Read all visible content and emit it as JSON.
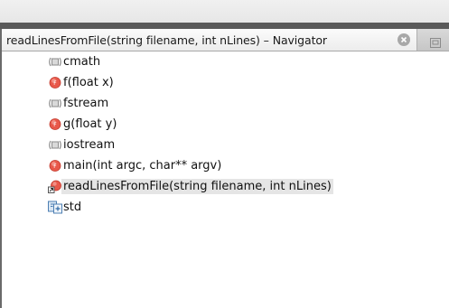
{
  "tab": {
    "title": "readLinesFromFile(string filename, int nLines) – Navigator"
  },
  "items": [
    {
      "label": "cmath",
      "icon": "include-icon"
    },
    {
      "label": "f(float x)",
      "icon": "function-icon"
    },
    {
      "label": "fstream",
      "icon": "include-icon"
    },
    {
      "label": "g(float y)",
      "icon": "function-icon"
    },
    {
      "label": "iostream",
      "icon": "include-icon"
    },
    {
      "label": "main(int argc, char** argv)",
      "icon": "function-icon"
    },
    {
      "label": "readLinesFromFile(string filename, int nLines)",
      "icon": "function-selected-icon",
      "selected": true
    },
    {
      "label": "std",
      "icon": "namespace-icon"
    }
  ],
  "colors": {
    "function": "#e8584a",
    "include": "#8a8a8a",
    "selection": "#e5e5e5"
  }
}
